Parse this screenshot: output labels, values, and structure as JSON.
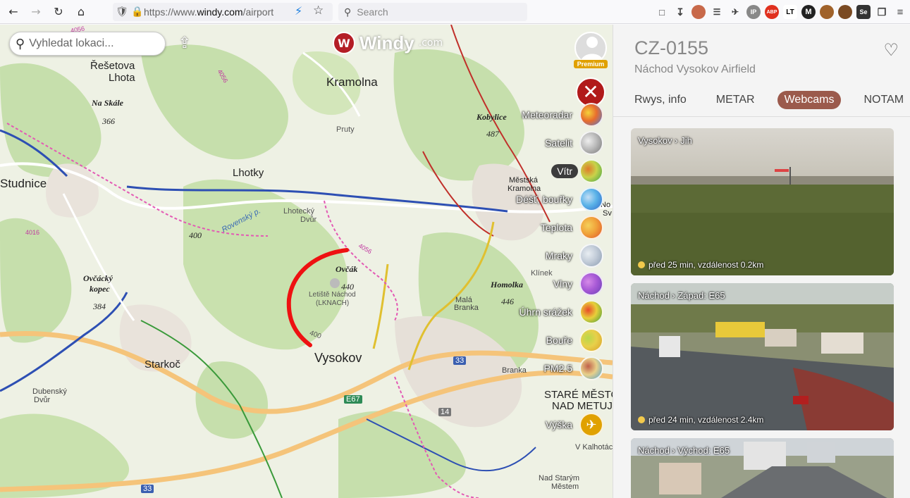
{
  "browser": {
    "url_prefix": "https://www.",
    "url_domain": "windy.com",
    "url_suffix": "/airport",
    "search_placeholder": "Search",
    "ext_ip": "IP",
    "ext_abp": "ABP",
    "ext_lt": "LT",
    "ext_se": "Se"
  },
  "map": {
    "search_placeholder": "Vyhledat lokaci...",
    "logo_text": "Windy",
    "logo_suffix": ".com",
    "premium_label": "Premium",
    "labels": {
      "resetova": "Řešetova",
      "lhota": "Lhota",
      "na_skale": "Na Skále",
      "na_skale_h": "366",
      "kramolna": "Kramolna",
      "kobylice": "Kobylice",
      "kobylice_h": "487",
      "pruty": "Pruty",
      "studnice": "Studnice",
      "lhotky": "Lhotky",
      "mestska": "Městská",
      "kramolna2": "Kramolna",
      "lhotecky": "Lhotecký",
      "dvur": "Dvůr",
      "rovensky": "Rovenský p.",
      "h400a": "400",
      "ovcak": "Ovčák",
      "h440": "440",
      "letiste": "Letiště Náchod",
      "lknach": "(LKNACH)",
      "h400b": "400",
      "ovcacky": "Ovčácký",
      "kopec": "kopec",
      "h384": "384",
      "mala": "Malá",
      "branka": "Branka",
      "homolka": "Homolka",
      "h446": "446",
      "klinek": "Klínek",
      "vysokov": "Vysokov",
      "starkoc": "Starkoč",
      "dubensky": "Dubenský",
      "dvur2": "Dvůr",
      "branka2": "Branka",
      "stare": "STARÉ MĚSTO",
      "nad": "NAD METUJÍ",
      "e67": "E67",
      "r33a": "33",
      "r14": "14",
      "r33b": "33",
      "v_kalhotach": "V Kalhotách",
      "nad_starym": "Nad Starým",
      "mestem": "Městem",
      "road4056a": "4056",
      "road4056b": "4056",
      "road4016": "4016",
      "road4056c": "4056",
      "nov": "No",
      "sv": "Sv"
    },
    "layers": [
      {
        "label": "Meteoradar",
        "colors": [
          "#4b7bd8",
          "#e86c2d",
          "#f5d23a"
        ]
      },
      {
        "label": "Satelit",
        "colors": [
          "#777777",
          "#bbbbbb",
          "#eeeeee"
        ]
      },
      {
        "label": "Vítr",
        "colors": [
          "#3da34a",
          "#c8d34a",
          "#e07a2a"
        ],
        "active": true
      },
      {
        "label": "Déšť, bouřky",
        "colors": [
          "#2f68c8",
          "#5bb3e8",
          "#c4def5"
        ]
      },
      {
        "label": "Teplota",
        "colors": [
          "#e0562b",
          "#f0a23a",
          "#f5d05a"
        ]
      },
      {
        "label": "Mraky",
        "colors": [
          "#8a9bb0",
          "#c2ccd8",
          "#e8edf2"
        ]
      },
      {
        "label": "Vlny",
        "colors": [
          "#6a3fb5",
          "#a85ad6",
          "#d68ae8"
        ]
      },
      {
        "label": "Úhrn srážek",
        "colors": [
          "#3a9a3a",
          "#e8d03a",
          "#e84a2a"
        ]
      },
      {
        "label": "Bouře",
        "colors": [
          "#d8a02a",
          "#e8d04a",
          "#b8d84a"
        ]
      },
      {
        "label": "PM2.5",
        "colors": [
          "#4aa0d0",
          "#e8d08a",
          "#c0604a"
        ]
      },
      {
        "label": "Výška",
        "colors": [
          "#e0a100",
          "#e0a100",
          "#e0a100"
        ]
      }
    ]
  },
  "panel": {
    "code": "CZ-0155",
    "name": "Náchod Vysokov Airfield",
    "tabs": [
      {
        "label": "Rwys, info"
      },
      {
        "label": "METAR"
      },
      {
        "label": "Webcams",
        "active": true
      },
      {
        "label": "NOTAM"
      }
    ],
    "webcams": [
      {
        "title": "Vysokov › Jih",
        "meta": "před 25 min, vzdálenost 0.2km"
      },
      {
        "title": "Náchod › Západ: E65",
        "meta": "před 24 min, vzdálenost 2.4km"
      },
      {
        "title": "Náchod › Východ: E65",
        "meta": ""
      }
    ]
  }
}
